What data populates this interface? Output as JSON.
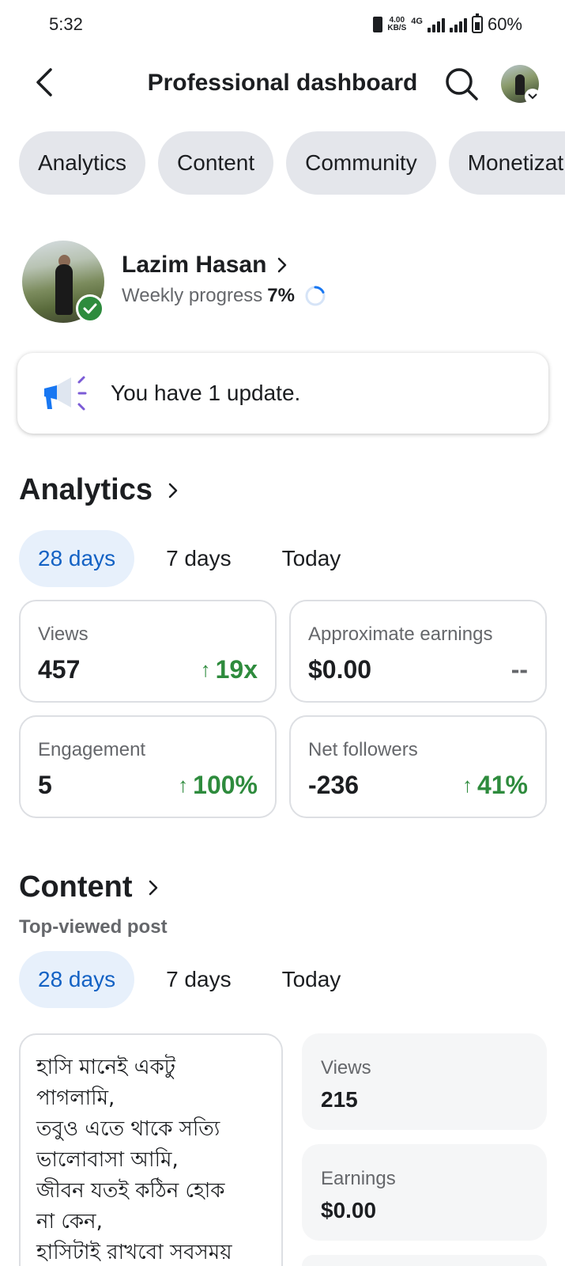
{
  "status_bar": {
    "time": "5:32",
    "net_speed": "4.00",
    "net_unit": "KB/S",
    "network_type": "4G",
    "battery": "60%"
  },
  "header": {
    "title": "Professional dashboard",
    "back_icon": "back-arrow-icon",
    "search_icon": "search-icon"
  },
  "tabs": [
    "Analytics",
    "Content",
    "Community",
    "Monetization"
  ],
  "profile": {
    "name": "Lazim Hasan",
    "progress_label": "Weekly progress",
    "progress_value": "7%",
    "progress_fraction": 0.07
  },
  "update": {
    "text": "You have 1 update."
  },
  "analytics": {
    "title": "Analytics",
    "ranges": [
      "28 days",
      "7 days",
      "Today"
    ],
    "active_range": "28 days",
    "metrics": [
      {
        "label": "Views",
        "value": "457",
        "change": "19x",
        "trend": "up"
      },
      {
        "label": "Approximate earnings",
        "value": "$0.00",
        "change": "--",
        "trend": "none"
      },
      {
        "label": "Engagement",
        "value": "5",
        "change": "100%",
        "trend": "up"
      },
      {
        "label": "Net followers",
        "value": "-236",
        "change": "41%",
        "trend": "up"
      }
    ]
  },
  "content": {
    "title": "Content",
    "subtitle": "Top-viewed post",
    "ranges": [
      "28 days",
      "7 days",
      "Today"
    ],
    "active_range": "28 days",
    "post_lines": [
      "হাসি মানেই একটু",
      "পাগলামি,",
      "তবুও এতে থাকে সত্যি",
      "ভালোবাসা আমি,",
      "জীবন যতই কঠিন হোক",
      "না কেন,",
      "হাসিটাই রাখবো সবসময়"
    ],
    "stats": [
      {
        "label": "Views",
        "value": "215"
      },
      {
        "label": "Earnings",
        "value": "$0.00"
      }
    ]
  },
  "colors": {
    "accent": "#1462c4",
    "positive": "#2e8b3d",
    "chip_bg": "#e4e6eb",
    "active_range_bg": "#e7f0fb"
  }
}
